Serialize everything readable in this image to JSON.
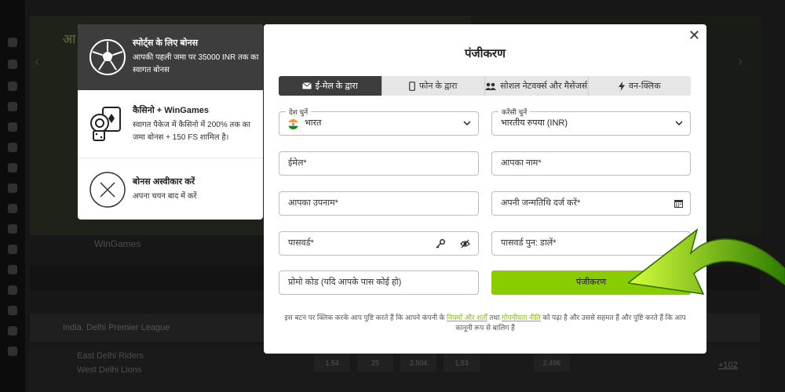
{
  "background": {
    "banner_title": "आ",
    "wingames_label": "WinGames",
    "league": "India. Delhi Premier League",
    "teams": [
      "East Delhi Riders",
      "West Delhi Lions"
    ],
    "odds": [
      "1.54",
      "25",
      "2.504",
      "1.53",
      "2.496"
    ],
    "more": "+102"
  },
  "bonus_panel": {
    "items": [
      {
        "title": "स्पोर्ट्स के लिए बोनस",
        "desc": "आपकी पहली जमा पर 35000 INR तक का स्वागत बोनस",
        "icon": "soccer-ball-icon"
      },
      {
        "title": "कैसिनो + WinGames",
        "desc": "स्वागत पैकेज में कैसिनो में 200% तक का जमा बोनस + 150 FS शामिल है।",
        "icon": "casino-cards-icon"
      },
      {
        "title": "बोनस अस्वीकार करें",
        "desc": "अपना चयन बाद में करें",
        "icon": "decline-x-icon"
      }
    ]
  },
  "modal": {
    "title": "पंजीकरण",
    "close": "✕",
    "tabs": [
      {
        "label": "ई-मेल के द्वारा",
        "icon": "envelope-icon",
        "active": true
      },
      {
        "label": "फोन के द्वारा",
        "icon": "phone-icon",
        "active": false
      },
      {
        "label": "सोशल नेटवर्क्स और मैसेंजर्स",
        "icon": "users-icon",
        "active": false
      },
      {
        "label": "वन-क्लिक",
        "icon": "lightning-icon",
        "active": false
      }
    ],
    "country": {
      "label": "देश चुनें",
      "value": "भारत"
    },
    "currency": {
      "label": "करेंसी चुनें",
      "value": "भारतीय रुपया (INR)"
    },
    "email": {
      "placeholder": "ईमेल*"
    },
    "name": {
      "placeholder": "आपका नाम*"
    },
    "surname": {
      "placeholder": "आपका उपनाम*"
    },
    "dob": {
      "placeholder": "अपनी जन्मतिथि दर्ज करें*"
    },
    "password": {
      "placeholder": "पासवर्ड*"
    },
    "password_repeat": {
      "placeholder": "पासवर्ड पुन: डालें*"
    },
    "promo": {
      "placeholder": "प्रोमो कोड (यदि आपके पास कोई हो)"
    },
    "submit_label": "पंजीकरण",
    "terms": {
      "before": "इस बटन पर क्लिक करके आप पुष्टि करते हैं कि आपने कंपनी के",
      "link1": "नियमों और शर्तों",
      "mid": "तथा",
      "link2": "गोपनीयता नीति",
      "after": "को पढ़ा है और उससे सहमत हैं और पुष्टि करते हैं कि आप कानूनी रूप से बालिग हैं"
    }
  },
  "colors": {
    "accent": "#89cc00",
    "dark": "#3d3d3d",
    "arrow": "#6fb800"
  }
}
